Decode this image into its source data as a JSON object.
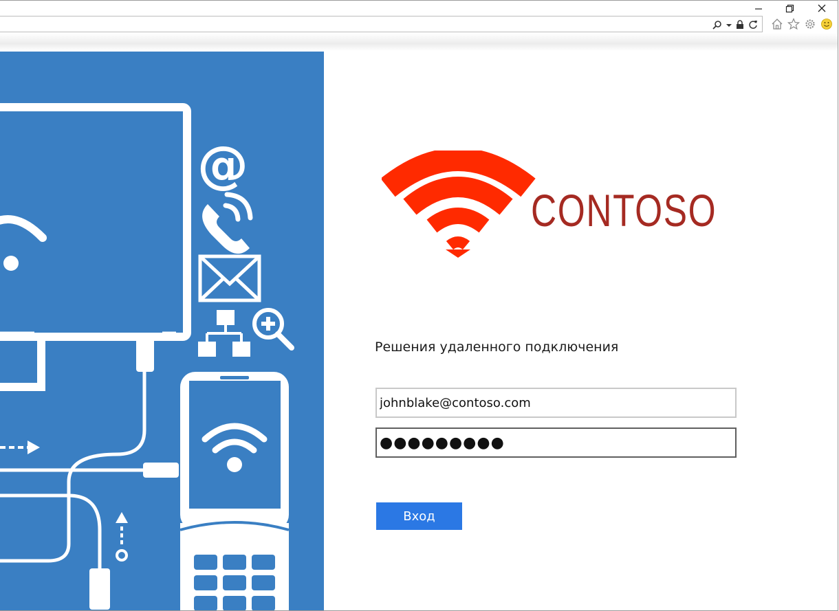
{
  "window": {
    "minimize_label": "—",
    "restore_label": "❐",
    "close_label": "✕"
  },
  "address_bar": {
    "value": "",
    "icons": [
      "search-icon",
      "dropdown-icon",
      "lock-icon",
      "refresh-icon"
    ]
  },
  "toolbar": {
    "icons": [
      "home-icon",
      "favorites-star-icon",
      "settings-gear-icon",
      "smiley-feedback-icon"
    ]
  },
  "hero": {
    "icons": [
      "monitor-icon",
      "email-at-icon",
      "phone-icon",
      "envelope-icon",
      "network-icon",
      "zoom-in-icon",
      "smartphone-icon",
      "wifi-icon"
    ]
  },
  "brand": {
    "name": "CONTOSO",
    "wordmark_color": "#a52a22",
    "logo_color": "#ff2a00"
  },
  "login": {
    "subtitle": "Решения удаленного подключения",
    "email_value": "johnblake@contoso.com",
    "password_value": "●●●●●●●●●",
    "submit_label": "Вход",
    "accent_color": "#2b78e4"
  },
  "colors": {
    "hero_background": "#3a7fc3"
  }
}
